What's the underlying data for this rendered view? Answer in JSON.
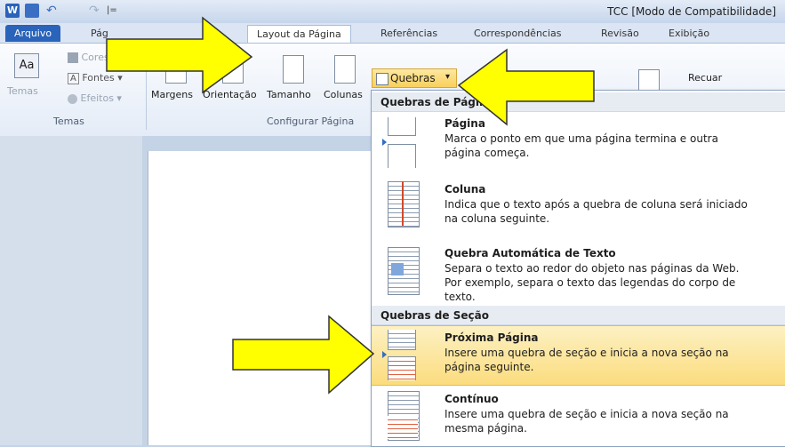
{
  "window": {
    "title": "TCC [Modo de Compatibilidade]"
  },
  "tabs": [
    {
      "label": "Arquivo"
    },
    {
      "label": "Pág"
    },
    {
      "label": "Layout da Página"
    },
    {
      "label": "Referências"
    },
    {
      "label": "Correspondências"
    },
    {
      "label": "Revisão"
    },
    {
      "label": "Exibição"
    }
  ],
  "ribbon": {
    "temas": {
      "button": "Temas",
      "cores": "Cores",
      "fontes": "Fontes",
      "efeitos": "Efeitos",
      "group": "Temas"
    },
    "config": {
      "margens": "Margens",
      "orientacao": "Orientação",
      "tamanho": "Tamanho",
      "colunas": "Colunas",
      "group": "Configurar Página"
    },
    "quebras": "Quebras",
    "recuar": "Recuar"
  },
  "menu": {
    "section1": "Quebras de Página",
    "section2": "Quebras de Seção",
    "items": [
      {
        "title": "Página",
        "desc": "Marca o ponto em que uma página termina e outra página começa."
      },
      {
        "title": "Coluna",
        "desc": "Indica que o texto após a quebra de coluna será iniciado na coluna seguinte."
      },
      {
        "title": "Quebra Automática de Texto",
        "desc": "Separa o texto ao redor do objeto nas páginas da Web. Por exemplo, separa o texto das legendas do corpo de texto."
      },
      {
        "title": "Próxima Página",
        "desc": "Insere uma quebra de seção e inicia a nova seção na página seguinte."
      },
      {
        "title": "Contínuo",
        "desc": "Insere uma quebra de seção e inicia a nova seção na mesma página."
      }
    ]
  },
  "colors": {
    "accent": "#2a63ba",
    "highlight": "#fde59b",
    "arrow": "#ffff00"
  }
}
